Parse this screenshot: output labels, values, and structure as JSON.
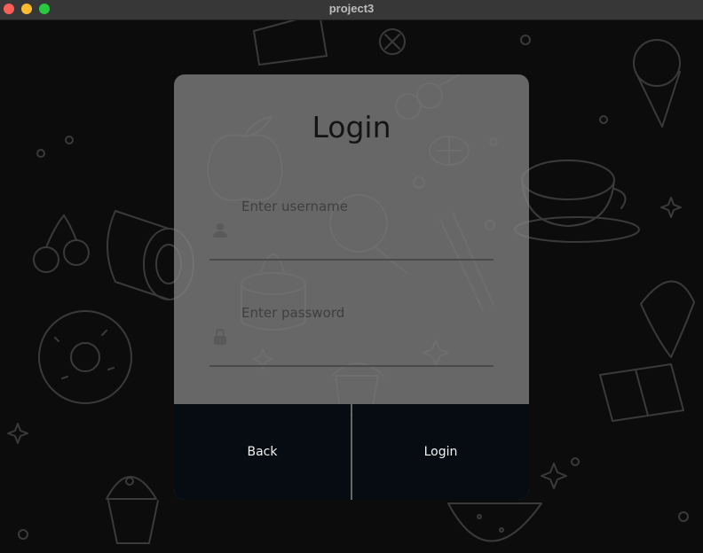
{
  "window": {
    "title": "project3",
    "controls": [
      "close",
      "minimize",
      "maximize"
    ]
  },
  "login_card": {
    "heading": "Login",
    "username": {
      "placeholder": "Enter username",
      "value": "",
      "icon": "person-icon"
    },
    "password": {
      "placeholder": "Enter password",
      "value": "",
      "icon": "lock-icon"
    },
    "back_button": "Back",
    "login_button": "Login"
  },
  "colors": {
    "titlebar": "#373737",
    "background": "#0c0c0c",
    "doodle_stroke": "#3a3a3a",
    "card": "#828282",
    "button": "#070b12",
    "close": "#fe5f57",
    "minimize": "#febc2e",
    "maximize": "#28c840"
  }
}
